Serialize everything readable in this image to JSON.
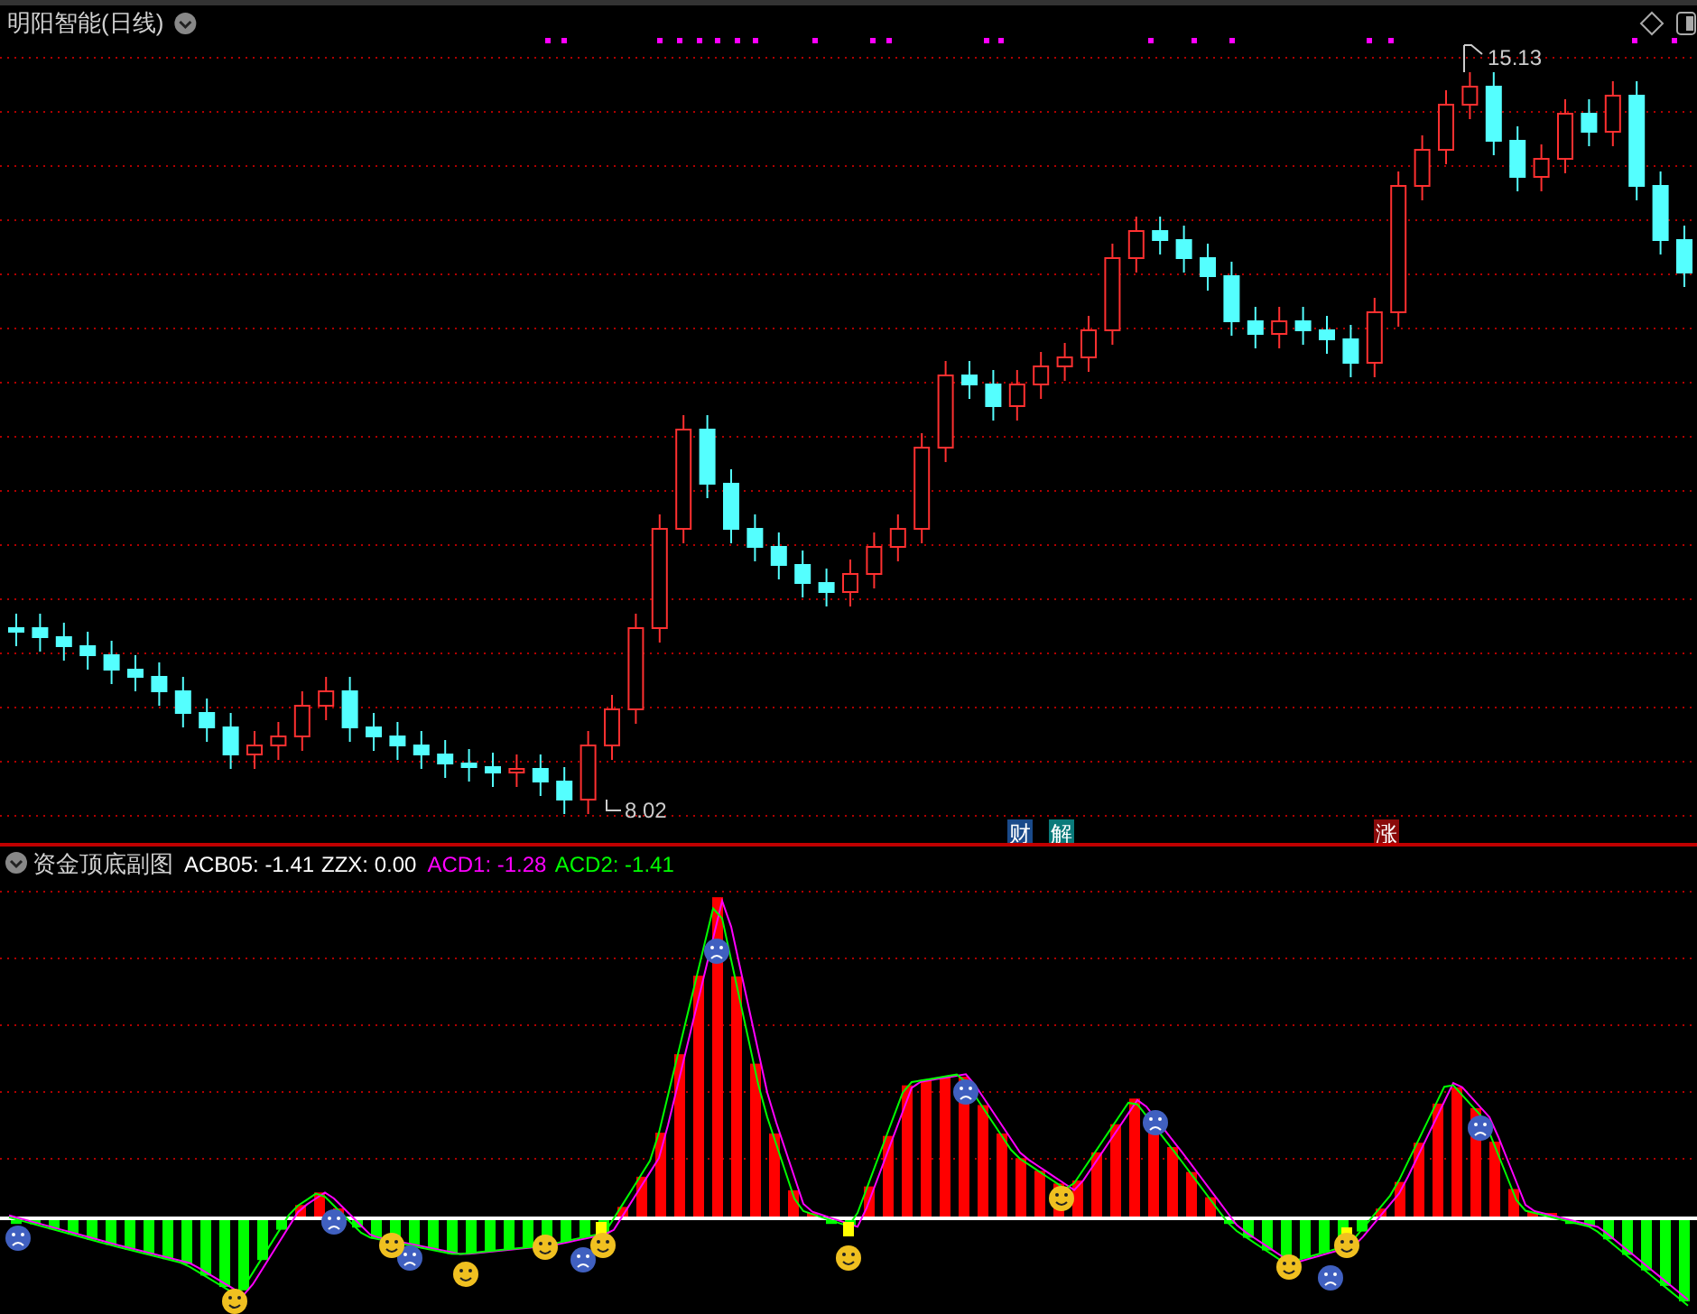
{
  "main_chart": {
    "title": "明阳智能(日线)",
    "high_label": "15.13",
    "low_label": "8.02",
    "markers": [
      {
        "text": "财",
        "color": "#1a4a8a"
      },
      {
        "text": "解",
        "color": "#0a7a7a"
      },
      {
        "text": "涨",
        "color": "#8a0a0a"
      }
    ]
  },
  "sub_chart": {
    "title": "资金顶底副图",
    "readouts": [
      {
        "text": "ACB05: -1.41",
        "color": "#ffffff"
      },
      {
        "text": "ZZX: 0.00",
        "color": "#ffffff"
      },
      {
        "text": "ACD1: -1.28",
        "color": "#ff00ff"
      },
      {
        "text": "ACD2: -1.41",
        "color": "#00ff00"
      }
    ]
  }
}
